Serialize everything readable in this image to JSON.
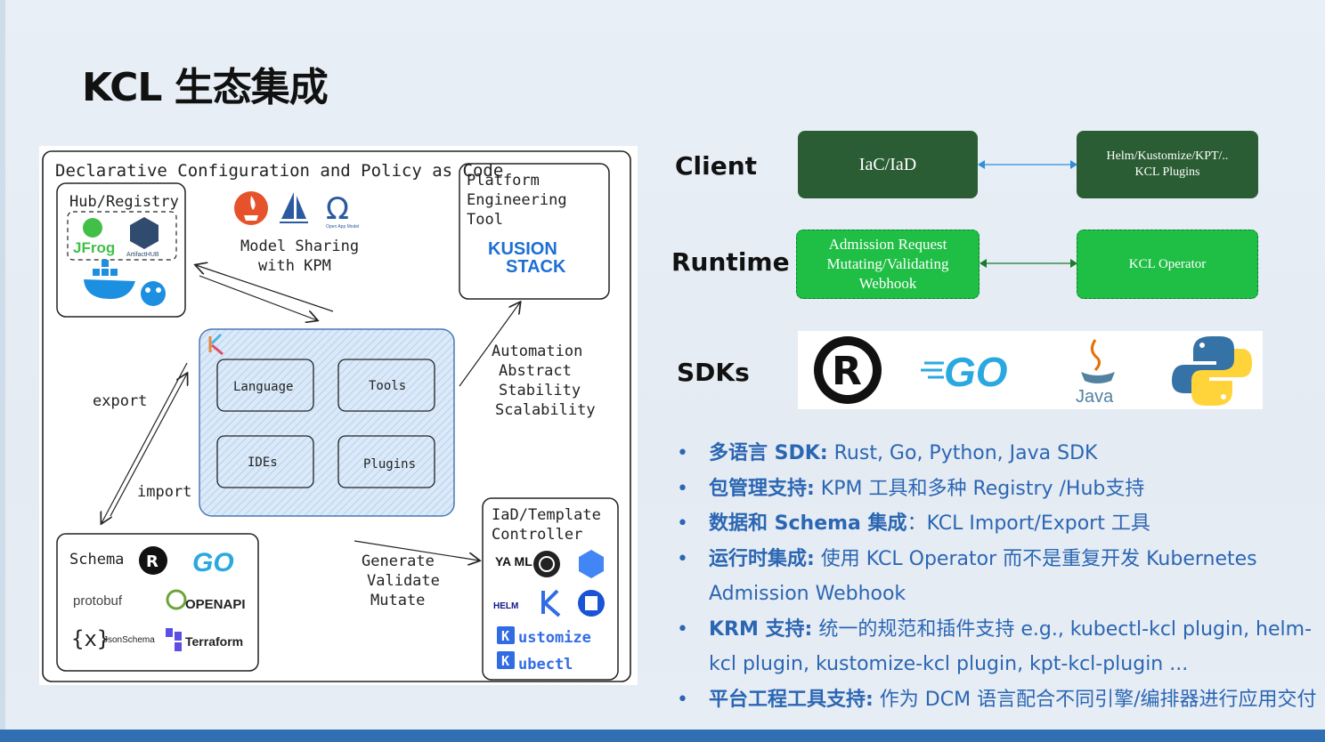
{
  "title": "KCL 生态集成",
  "diagram": {
    "frame_title": "Declarative Configuration and Policy as Code",
    "hub_title": "Hub/Registry",
    "hub_logos": [
      "JFrog",
      "ArtifactHUB"
    ],
    "model_sharing": [
      "Model Sharing",
      "with KPM"
    ],
    "oam_label": "Open App Model",
    "platform_title": [
      "Platform",
      "Engineering",
      "Tool"
    ],
    "kusion": [
      "KUSION",
      "STACK"
    ],
    "core_boxes": [
      "Language",
      "Tools",
      "IDEs",
      "Plugins"
    ],
    "export_label": "export",
    "import_label": "import",
    "automation": [
      "Automation",
      "Abstract",
      "Stability",
      "Scalability"
    ],
    "schema_title": "Schema",
    "schema_logos": [
      "GO",
      "protobuf",
      "OPENAPI",
      "JsonSchema",
      "Terraform"
    ],
    "generate": [
      "Generate",
      "Validate",
      "Mutate"
    ],
    "iad_title": [
      "IaD/Template",
      "Controller"
    ],
    "iad_logos": [
      "YA ML",
      "HELM",
      "ustomize",
      "ubectl"
    ]
  },
  "client": {
    "label": "Client",
    "left": "IaC/IaD",
    "right": [
      "Helm/Kustomize/KPT/..",
      "KCL Plugins"
    ]
  },
  "runtime": {
    "label": "Runtime",
    "left": [
      "Admission Request",
      "Mutating/Validating",
      "Webhook"
    ],
    "right": "KCL Operator"
  },
  "sdks": {
    "label": "SDKs",
    "go": "GO",
    "java": "Java"
  },
  "colors": {
    "dark_green": "#2a5d34",
    "bright_green": "#1fbe45",
    "text_blue": "#2b66b3"
  },
  "bullets": [
    {
      "bold": "多语言 SDK:",
      "text": " Rust, Go, Python, Java SDK"
    },
    {
      "bold": "包管理支持:",
      "text": " KPM 工具和多种 Registry /Hub支持"
    },
    {
      "bold": "数据和 Schema 集成",
      "text": "：KCL Import/Export 工具"
    },
    {
      "bold": "运行时集成:",
      "text": " 使用 KCL Operator 而不是重复开发 Kubernetes Admission Webhook"
    },
    {
      "bold": "KRM 支持:",
      "text": " 统一的规范和插件支持 e.g., kubectl-kcl plugin, helm-kcl plugin, kustomize-kcl plugin, kpt-kcl-plugin ..."
    },
    {
      "bold": "平台工程工具支持:",
      "text": " 作为 DCM 语言配合不同引擎/编排器进行应用交付"
    }
  ]
}
